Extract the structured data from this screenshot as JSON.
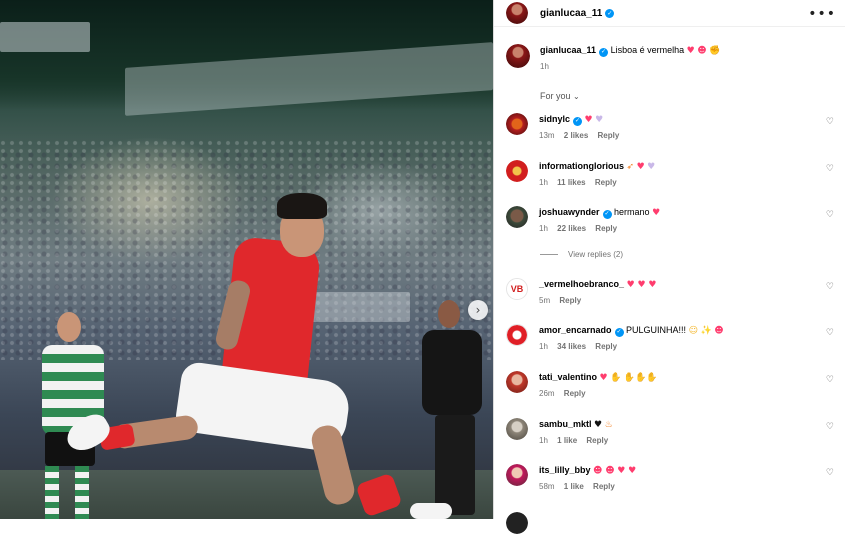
{
  "post": {
    "author": "gianlucaa_11",
    "caption_text": "Lisboa é vermelha",
    "caption_time": "1h",
    "more_icon": "more-horizontal-icon",
    "next_icon": "chevron-right-icon",
    "next_glyph": "›",
    "more_glyph": "•••",
    "accent_color": "#0095f6"
  },
  "filter": {
    "label": "For you",
    "chevron": "⌄"
  },
  "comments": [
    {
      "user": "sidnylc",
      "verified": true,
      "text": "",
      "time": "13m",
      "likes": "2 likes",
      "reply": "Reply"
    },
    {
      "user": "informationglorious",
      "verified": false,
      "text": "",
      "time": "1h",
      "likes": "11 likes",
      "reply": "Reply"
    },
    {
      "user": "joshuawynder",
      "verified": true,
      "text": "hermano",
      "time": "1h",
      "likes": "22 likes",
      "reply": "Reply",
      "view_replies": "View replies (2)"
    },
    {
      "user": "_vermelhoebranco_",
      "verified": false,
      "text": "",
      "time": "5m",
      "likes": "",
      "reply": "Reply"
    },
    {
      "user": "amor_encarnado",
      "verified": true,
      "text": "PULGUINHA!!!",
      "time": "1h",
      "likes": "34 likes",
      "reply": "Reply"
    },
    {
      "user": "tati_valentino",
      "verified": false,
      "text": "",
      "time": "26m",
      "likes": "",
      "reply": "Reply"
    },
    {
      "user": "sambu_mktl",
      "verified": false,
      "text": "",
      "time": "1h",
      "likes": "1 like",
      "reply": "Reply"
    },
    {
      "user": "its_lilly_bby",
      "verified": false,
      "text": "",
      "time": "58m",
      "likes": "1 like",
      "reply": "Reply"
    }
  ],
  "like_icon": "heart-outline-icon",
  "like_glyph": "♡"
}
